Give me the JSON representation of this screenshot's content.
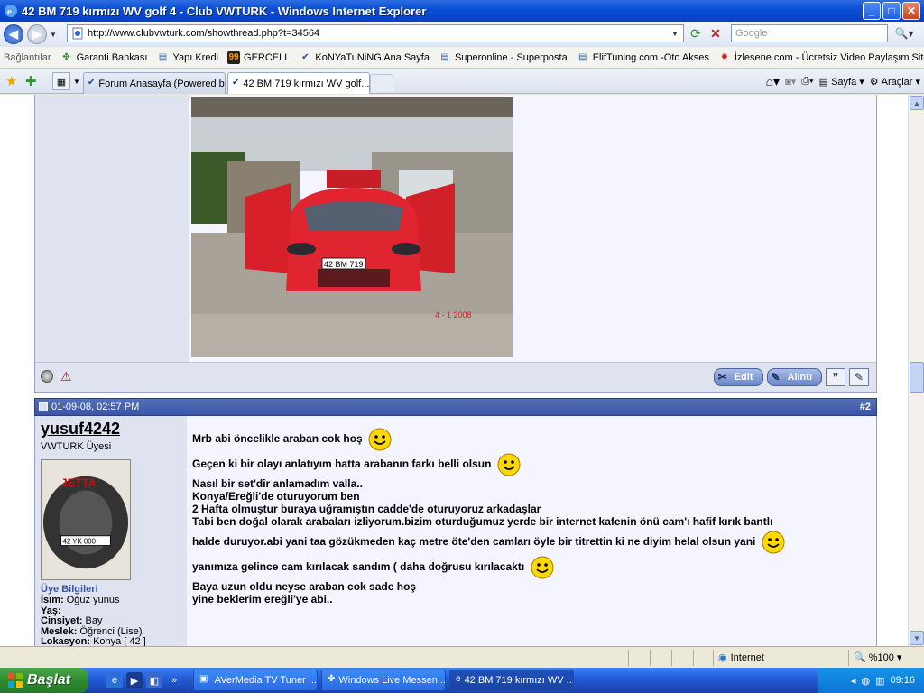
{
  "window": {
    "title": "42 BM 719 kırmızı WV golf 4 - Club VWTURK - Windows Internet Explorer",
    "min": "_",
    "max": "□",
    "close": "✕"
  },
  "address": {
    "url": "http://www.clubvwturk.com/showthread.php?t=34564",
    "search_placeholder": "Google"
  },
  "links": {
    "label": "Bağlantılar",
    "items": [
      {
        "label": "Garanti Bankası",
        "icon": "clover-icon"
      },
      {
        "label": "Yapı Kredi",
        "icon": "page-icon"
      },
      {
        "label": "GERCELL",
        "icon": "gercell-icon"
      },
      {
        "label": "KoNYaTuNiNG  Ana Sayfa",
        "icon": "vw-icon"
      },
      {
        "label": "Superonline - Superposta",
        "icon": "ie-page-icon"
      },
      {
        "label": "ElifTuning.com -Oto Akses",
        "icon": "ie-page-icon"
      },
      {
        "label": "İzlesene.com - Ücretsiz Video Paylaşım Sitesi",
        "icon": "izlesene-icon"
      }
    ]
  },
  "tabs": [
    {
      "label": "Forum Anasayfa (Powered b...",
      "active": false
    },
    {
      "label": "42 BM 719 kırmızı WV golf...",
      "active": true
    }
  ],
  "toolbar": {
    "page_label": "Sayfa",
    "tools_label": "Araçlar"
  },
  "post1": {
    "photo_plate": "42 BM 719",
    "photo_date": "4 - 1 2008",
    "edit_label": "Edit",
    "quote_label": "Alıntı"
  },
  "post2": {
    "date": "01-09-08, 02:57 PM",
    "number": "#2",
    "username": "yusuf4242",
    "usertitle": "VWTURK Üyesi",
    "avatar_text": "JETTA",
    "avatar_plate": "42 YK 000",
    "info_title": "Üye Bilgileri",
    "info": [
      {
        "k": "İsim:",
        "v": " Oğuz yunus"
      },
      {
        "k": "Yaş:",
        "v": ""
      },
      {
        "k": "Cinsiyet:",
        "v": " Bay"
      },
      {
        "k": "Meslek:",
        "v": " Öğrenci (Lise)"
      },
      {
        "k": "Lokasyon:",
        "v": " Konya [ 42 ]"
      }
    ],
    "lines": [
      "Mrb abi öncelikle araban cok hoş",
      "Geçen ki bir olayı anlatıyım hatta arabanın farkı belli olsun",
      "Nasıl bir set'dir anlamadım valla..",
      "Konya/Ereğli'de oturuyorum ben",
      "2 Hafta olmuştur buraya uğramıştın cadde'de oturuyoruz arkadaşlar",
      "Tabi ben doğal olarak arabaları izliyorum.bizim oturduğumuz yerde bir internet kafenin önü cam'ı hafif kırık bantlı",
      "halde duruyor.abi yani taa gözükmeden kaç metre öte'den camları öyle bir titrettin ki ne diyim helal olsun yani",
      "yanımıza gelince cam kırılacak sandım ( daha doğrusu kırılacaktı",
      "Baya uzun oldu neyse araban cok sade hoş",
      "yine beklerim ereğli'ye abi.."
    ]
  },
  "status": {
    "zone": "Internet",
    "zoom": "%100"
  },
  "taskbar": {
    "start": "Başlat",
    "tasks": [
      {
        "label": "AVerMedia TV Tuner ...",
        "active": false
      },
      {
        "label": "Windows Live Messen...",
        "active": false
      },
      {
        "label": "42 BM 719 kırmızı WV ...",
        "active": true
      }
    ],
    "lang": "TR",
    "clock": "09:16"
  }
}
